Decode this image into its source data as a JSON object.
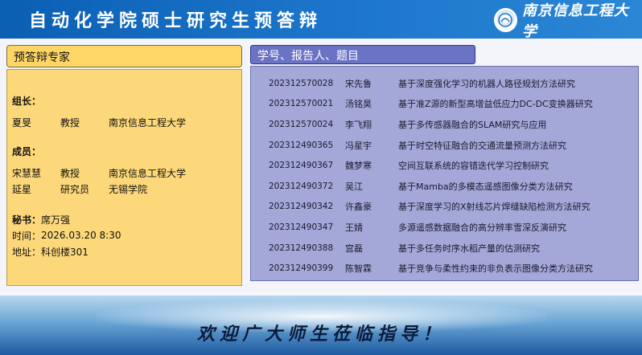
{
  "header": {
    "title": "自动化学院硕士研究生预答辩",
    "logo_text": "南京信息工程大学"
  },
  "experts": {
    "heading": "预答辩专家",
    "leader_label": "组长：",
    "leader": {
      "name": "夏旻",
      "title": "教授",
      "org": "南京信息工程大学"
    },
    "members_label": "成员：",
    "members": [
      {
        "name": "宋慧慧",
        "title": "教授",
        "org": "南京信息工程大学"
      },
      {
        "name": "延星",
        "title": "研究员",
        "org": "无锡学院"
      }
    ],
    "secretary_label": "秘书：",
    "secretary": "席万强",
    "time_label": "时间：",
    "time": "2026.03.20  8:30",
    "place_label": "地址：",
    "place": "科创楼301"
  },
  "students": {
    "heading": "学号、报告人、题目",
    "rows": [
      {
        "id": "202312570028",
        "name": "宋先鲁",
        "title": "基于深度强化学习的机器人路径规划方法研究"
      },
      {
        "id": "202312570021",
        "name": "汤铭昊",
        "title": "基于准Z源的新型高增益低应力DC-DC变换器研究"
      },
      {
        "id": "202312570024",
        "name": "李飞翔",
        "title": "基于多传感器融合的SLAM研究与应用"
      },
      {
        "id": "202312490365",
        "name": "冯星宇",
        "title": "基于时空特征融合的交通流量预测方法研究"
      },
      {
        "id": "202312490367",
        "name": "魏梦寒",
        "title": "空间互联系统的容错迭代学习控制研究"
      },
      {
        "id": "202312490372",
        "name": "吴江",
        "title": "基于Mamba的多模态遥感图像分类方法研究"
      },
      {
        "id": "202312490342",
        "name": "许鑫豪",
        "title": "基于深度学习的X射线芯片焊缝缺陷检测方法研究"
      },
      {
        "id": "202312490347",
        "name": "王婧",
        "title": "多源遥感数据融合的高分辨率雪深反演研究"
      },
      {
        "id": "202312490388",
        "name": "宫磊",
        "title": "基于多任务时序水稻产量的估测研究"
      },
      {
        "id": "202312490399",
        "name": "陈智霖",
        "title": "基于竞争与柔性约束的非负表示图像分类方法研究"
      }
    ]
  },
  "footer": {
    "text": "欢迎广大师生莅临指导！"
  },
  "colors": {
    "header_blue": "#1a73c8",
    "left_panel": "#fdd87a",
    "right_panel": "#a4a8d8",
    "right_header": "#6b74c4"
  }
}
